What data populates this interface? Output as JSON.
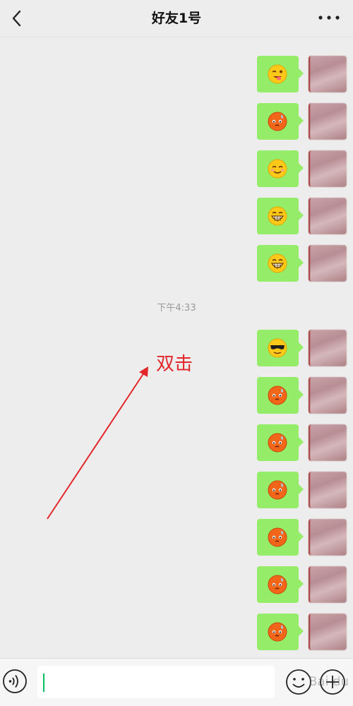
{
  "header": {
    "title": "好友1号",
    "back_icon": "chevron-left-icon",
    "more_icon": "more-dots-icon"
  },
  "chat": {
    "timestamp": "下午4:33",
    "messages_before": [
      {
        "emoji": "wink-tongue"
      },
      {
        "emoji": "sweat-face"
      },
      {
        "emoji": "smile-blush"
      },
      {
        "emoji": "grin"
      },
      {
        "emoji": "grin"
      }
    ],
    "messages_after": [
      {
        "emoji": "sunglasses"
      },
      {
        "emoji": "sweat-face"
      },
      {
        "emoji": "sweat-face"
      },
      {
        "emoji": "sweat-face"
      },
      {
        "emoji": "sweat-face"
      },
      {
        "emoji": "sweat-face"
      },
      {
        "emoji": "sweat-face"
      }
    ]
  },
  "annotation": {
    "label": "双击",
    "color": "#e2262a"
  },
  "input_bar": {
    "voice_icon": "voice-icon",
    "emoji_icon": "emoji-icon",
    "plus_icon": "plus-icon",
    "input_value": ""
  },
  "watermark": "Bai du",
  "colors": {
    "bubble": "#95ec69",
    "caret": "#07c160",
    "background": "#ededed"
  }
}
